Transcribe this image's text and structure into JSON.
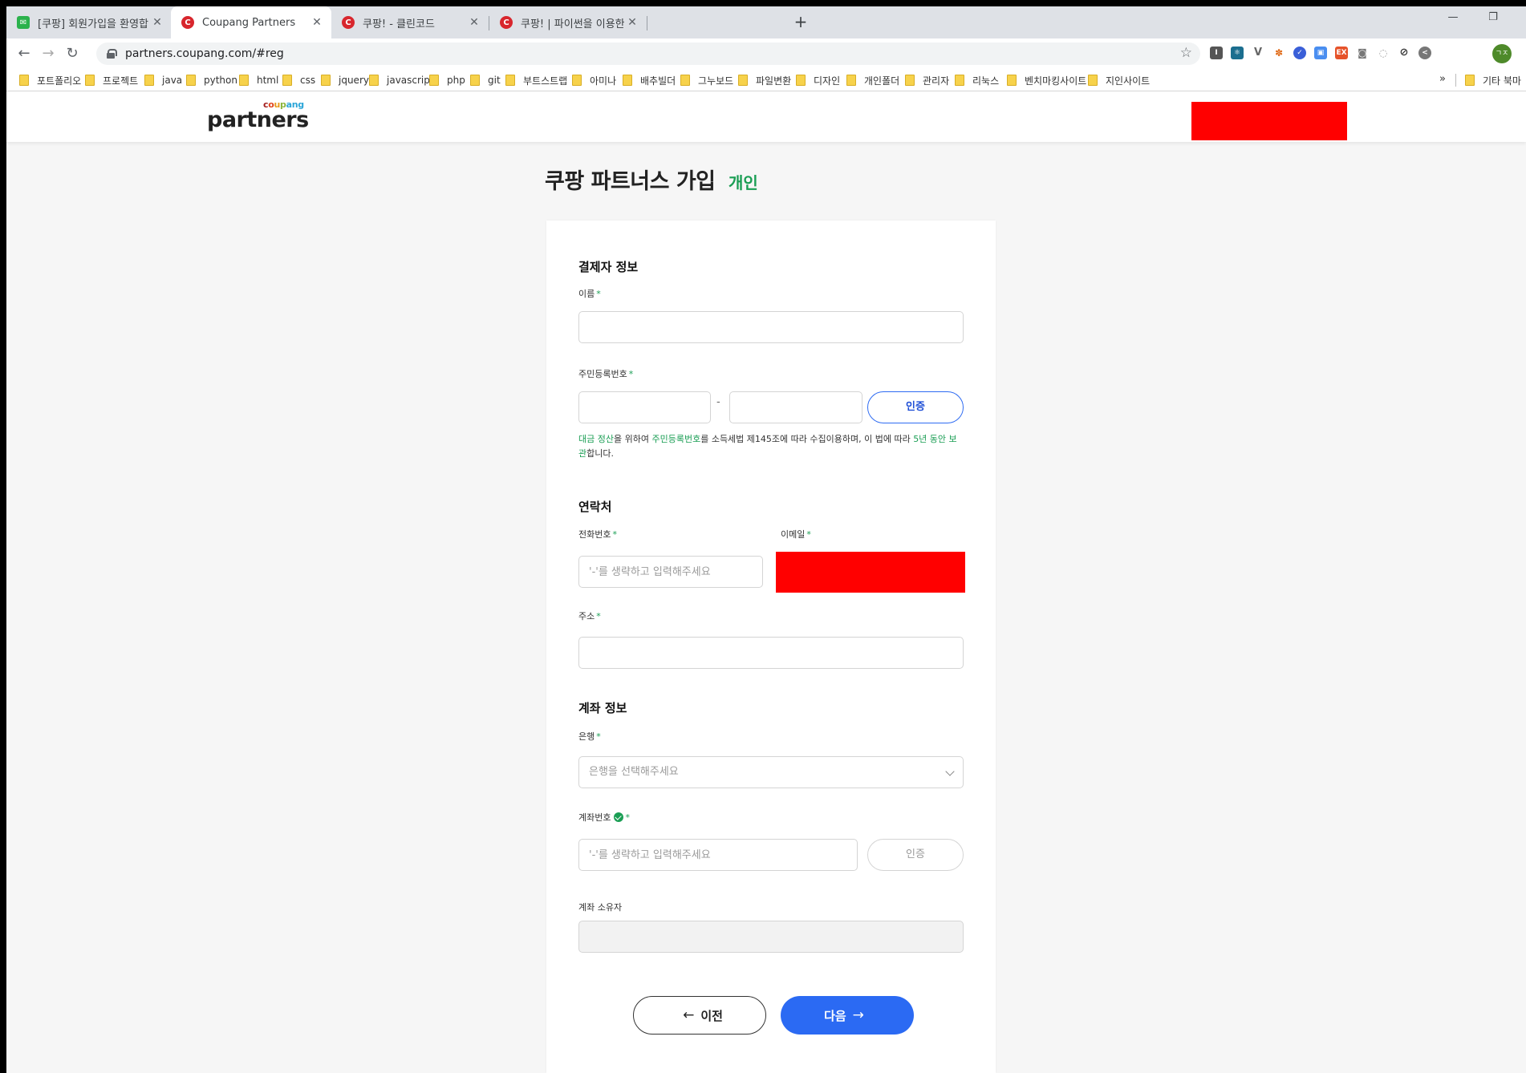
{
  "browser": {
    "tabs": [
      {
        "title": "[쿠팡] 회원가입을 환영합니다!",
        "active": false
      },
      {
        "title": "Coupang Partners",
        "active": true
      },
      {
        "title": "쿠팡! - 클린코드",
        "active": false
      },
      {
        "title": "쿠팡! | 파이썬을 이용한 클린 코",
        "active": false
      }
    ],
    "url": "partners.coupang.com/#reg",
    "bookmarks": [
      "포트폴리오",
      "프로젝트",
      "java",
      "python",
      "html",
      "css",
      "jquery",
      "javascript",
      "php",
      "git",
      "부트스트랩",
      "아미나",
      "배추빌더",
      "그누보드",
      "파일변환",
      "디자인",
      "개인폴더",
      "관리자",
      "리눅스",
      "벤치마킹사이트",
      "지인사이트"
    ],
    "bookmarks_more": "»",
    "other_bookmarks": "기타 북마",
    "profile_initials": "ㄱㅈ"
  },
  "header": {
    "logo_small": [
      "c",
      "o",
      "u",
      "p",
      "ang"
    ],
    "logo_main": "partners"
  },
  "page": {
    "title": "쿠팡 파트너스 가입",
    "subtitle": "개인"
  },
  "form": {
    "payer_section": "결제자 정보",
    "name_label": "이름",
    "rrn_label": "주민등록번호",
    "rrn_dash": "-",
    "verify_button": "인증",
    "notice": {
      "p1": "대금 정산",
      "p2": "을 위하여 ",
      "p3": "주민등록번호",
      "p4": "를 소득세법 제145조에 따라 수집이용하며, 이 법에 따라 ",
      "p5": "5년 동안 보관",
      "p6": "합니다."
    },
    "contact_section": "연락처",
    "phone_label": "전화번호",
    "phone_placeholder": "'-'를 생략하고 입력해주세요",
    "email_label": "이메일",
    "address_label": "주소",
    "account_section": "계좌 정보",
    "bank_label": "은행",
    "bank_placeholder": "은행을 선택해주세요",
    "account_number_label": "계좌번호",
    "account_number_placeholder": "'-'를 생략하고 입력해주세요",
    "account_verify_button": "인증",
    "account_holder_label": "계좌 소유자",
    "required_mark": "*",
    "prev_button": "이전",
    "next_button": "다음"
  },
  "colors": {
    "accent_green": "#1a9e54",
    "primary_blue": "#2b6af3",
    "redaction": "#ff0000"
  }
}
